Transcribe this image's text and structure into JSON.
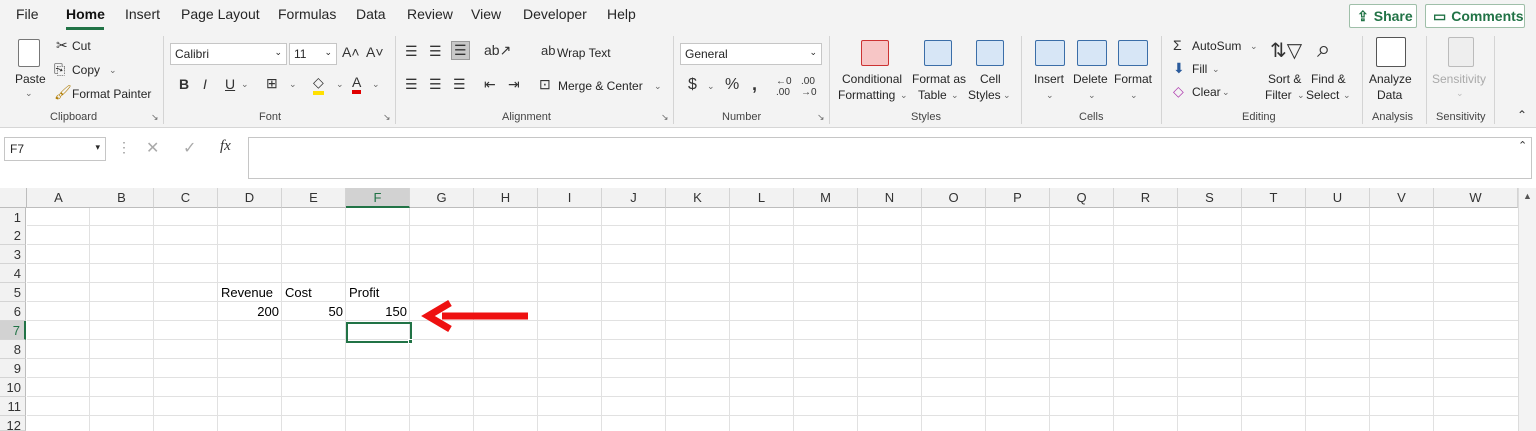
{
  "menu": {
    "tabs": [
      "File",
      "Home",
      "Insert",
      "Page Layout",
      "Formulas",
      "Data",
      "Review",
      "View",
      "Developer",
      "Help"
    ],
    "share": "Share",
    "comments": "Comments"
  },
  "clipboard": {
    "paste": "Paste",
    "cut": "Cut",
    "copy": "Copy",
    "format_painter": "Format Painter",
    "label": "Clipboard"
  },
  "font": {
    "name": "Calibri",
    "size": "11",
    "label": "Font",
    "bold": "B",
    "italic": "I",
    "underline": "U"
  },
  "alignment": {
    "wrap_text": "Wrap Text",
    "merge_center": "Merge & Center",
    "label": "Alignment"
  },
  "number": {
    "format": "General",
    "currency": "$",
    "percent": "%",
    "comma": ",",
    "label": "Number"
  },
  "styles": {
    "conditional": [
      "Conditional",
      "Formatting"
    ],
    "format_table": [
      "Format as",
      "Table"
    ],
    "cell_styles": [
      "Cell",
      "Styles"
    ],
    "label": "Styles"
  },
  "cells": {
    "insert": "Insert",
    "delete": "Delete",
    "format": "Format",
    "label": "Cells"
  },
  "editing": {
    "autosum": "AutoSum",
    "fill": "Fill",
    "clear": "Clear",
    "sort_filter": [
      "Sort &",
      "Filter"
    ],
    "find_select": [
      "Find &",
      "Select"
    ],
    "label": "Editing"
  },
  "analysis": {
    "analyze": [
      "Analyze",
      "Data"
    ],
    "label": "Analysis"
  },
  "sensitivity": {
    "button": "Sensitivity",
    "label": "Sensitivity"
  },
  "formula_bar": {
    "name_box": "F7",
    "fx": "fx",
    "value": ""
  },
  "columns": [
    "A",
    "B",
    "C",
    "D",
    "E",
    "F",
    "G",
    "H",
    "I",
    "J",
    "K",
    "L",
    "M",
    "N",
    "O",
    "P",
    "Q",
    "R",
    "S",
    "T",
    "U",
    "V",
    "W"
  ],
  "rows": [
    "1",
    "2",
    "3",
    "4",
    "5",
    "6",
    "7",
    "8",
    "9",
    "10",
    "11",
    "12"
  ],
  "cells_data": {
    "D5": "Revenue",
    "E5": "Cost",
    "F5": "Profit",
    "D6": "200",
    "E6": "50",
    "F6": "150"
  },
  "colors": {
    "accent": "#217346",
    "arrow": "#ee1111"
  }
}
